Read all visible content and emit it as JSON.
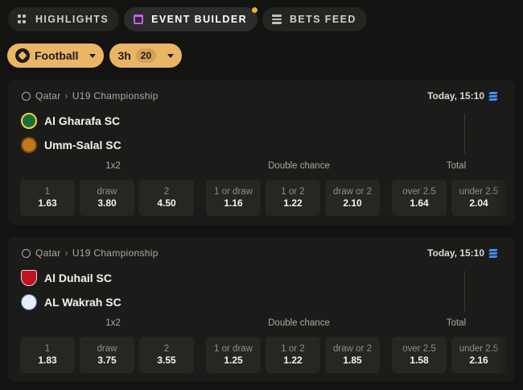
{
  "tabs": [
    {
      "label": "HIGHLIGHTS",
      "icon": "grid-icon",
      "active": false
    },
    {
      "label": "EVENT BUILDER",
      "icon": "calendar-icon",
      "active": true,
      "badge_color": "#f0a93a"
    },
    {
      "label": "BETS FEED",
      "icon": "feed-icon",
      "active": false
    }
  ],
  "filters": {
    "sport": "Football",
    "time": "3h",
    "count": "20",
    "accent": "#eab565"
  },
  "market_labels": {
    "group1": "1x2",
    "group2": "Double chance",
    "group3": "Total"
  },
  "events": [
    {
      "country": "Qatar",
      "league": "U19 Championship",
      "time": "Today, 15:10",
      "home": "Al Gharafa SC",
      "away": "Umm-Salal SC",
      "odds": [
        {
          "label": "1",
          "value": "1.63"
        },
        {
          "label": "draw",
          "value": "3.80"
        },
        {
          "label": "2",
          "value": "4.50"
        },
        {
          "label": "1 or draw",
          "value": "1.16"
        },
        {
          "label": "1 or 2",
          "value": "1.22"
        },
        {
          "label": "draw or 2",
          "value": "2.10"
        },
        {
          "label": "over 2.5",
          "value": "1.64"
        },
        {
          "label": "under 2.5",
          "value": "2.04"
        }
      ]
    },
    {
      "country": "Qatar",
      "league": "U19 Championship",
      "time": "Today, 15:10",
      "home": "Al Duhail SC",
      "away": "AL Wakrah SC",
      "odds": [
        {
          "label": "1",
          "value": "1.83"
        },
        {
          "label": "draw",
          "value": "3.75"
        },
        {
          "label": "2",
          "value": "3.55"
        },
        {
          "label": "1 or draw",
          "value": "1.25"
        },
        {
          "label": "1 or 2",
          "value": "1.22"
        },
        {
          "label": "draw or 2",
          "value": "1.85"
        },
        {
          "label": "over 2.5",
          "value": "1.58"
        },
        {
          "label": "under 2.5",
          "value": "2.16"
        }
      ]
    }
  ]
}
